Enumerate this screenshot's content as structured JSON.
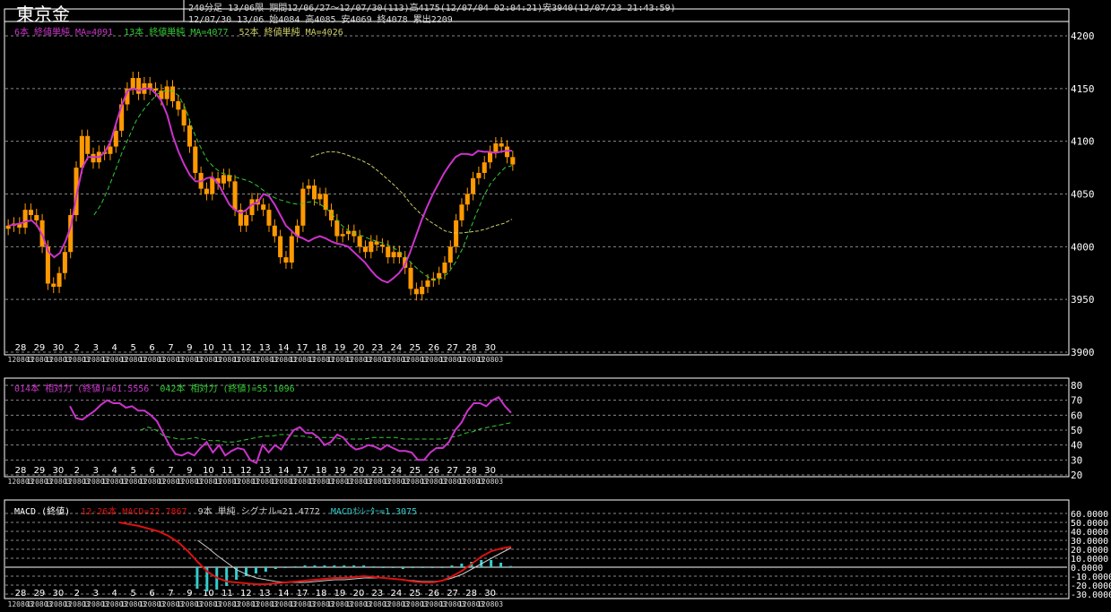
{
  "header": {
    "title": "東京金",
    "timeframe": "240分足 13/06限",
    "period": "期間12/06/27～12/07/30(113)高4175(12/07/04 02:04:21)安3940(12/07/23 21:43:59)",
    "last_bar": "12/07/30 13/06 始4084 高4085 安4069 終4078 累出2209"
  },
  "colors": {
    "background": "#000000",
    "candle_up": "#ff9900",
    "ma6": "#cc33cc",
    "ma13": "#33cc33",
    "ma52": "#cccc66",
    "rsi14": "#cc33cc",
    "rsi42": "#33cc33",
    "macd": "#dd1111",
    "signal": "#cccccc",
    "histogram": "#33cccc"
  },
  "legends": {
    "price": [
      {
        "text": "6本 終値単純 MA=4091",
        "color": "#cc33cc"
      },
      {
        "text": "13本 終値単純 MA=4077",
        "color": "#33cc33"
      },
      {
        "text": "52本 終値単純 MA=4026",
        "color": "#cccc66"
      }
    ],
    "rsi": [
      {
        "text": "014本 相対力 (終値)=61.5556",
        "color": "#cc33cc"
      },
      {
        "text": "042本 相対力 (終値)=55.1096",
        "color": "#33cc33"
      }
    ],
    "macd": [
      {
        "text": "MACD (終値)",
        "color": "#ffffff"
      },
      {
        "text": "12-26本 MACD=22.7867",
        "color": "#dd1111"
      },
      {
        "text": "9本 単純 シグナル=21.4772",
        "color": "#cccccc"
      },
      {
        "text": "MACDｵｼﾚｰﾀｰ=1.3075",
        "color": "#33cccc"
      }
    ]
  },
  "chart_data": [
    {
      "type": "candlestick",
      "title": "東京金 240分足 13/06限",
      "y_ticks": [
        3900,
        3950,
        4000,
        4050,
        4100,
        4150,
        4200
      ],
      "ylim": [
        3900,
        4200
      ],
      "x_tick_labels": [
        "28",
        "29",
        "30",
        "2",
        "3",
        "4",
        "5",
        "6",
        "7",
        "9",
        "10",
        "11",
        "12",
        "13",
        "14",
        "17",
        "18",
        "19",
        "20",
        "23",
        "24",
        "25",
        "26",
        "27",
        "28",
        "30"
      ],
      "x_tick_sublabels": "120803",
      "close": [
        4020,
        4022,
        4018,
        4035,
        4030,
        4025,
        4000,
        3965,
        3962,
        3975,
        3995,
        4030,
        4075,
        4105,
        4088,
        4080,
        4090,
        4088,
        4095,
        4110,
        4135,
        4150,
        4160,
        4145,
        4155,
        4150,
        4148,
        4140,
        4152,
        4138,
        4130,
        4115,
        4095,
        4070,
        4055,
        4050,
        4065,
        4060,
        4068,
        4062,
        4035,
        4020,
        4030,
        4045,
        4040,
        4035,
        4020,
        4010,
        3990,
        3985,
        4010,
        4020,
        4055,
        4058,
        4045,
        4050,
        4035,
        4025,
        4010,
        4012,
        4015,
        4010,
        4000,
        3995,
        4005,
        4002,
        4000,
        3990,
        3995,
        3990,
        3980,
        3960,
        3955,
        3962,
        3968,
        3970,
        3975,
        3985,
        4000,
        4025,
        4040,
        4050,
        4065,
        4070,
        4080,
        4090,
        4098,
        4095,
        4085,
        4078
      ],
      "ma6": [
        4020,
        4021,
        4022,
        4024,
        4025,
        4020,
        4010,
        3995,
        3990,
        3994,
        4005,
        4020,
        4050,
        4075,
        4085,
        4085,
        4085,
        4090,
        4100,
        4118,
        4135,
        4148,
        4150,
        4148,
        4150,
        4150,
        4145,
        4138,
        4125,
        4105,
        4090,
        4078,
        4068,
        4062,
        4062,
        4065,
        4066,
        4060,
        4050,
        4040,
        4035,
        4032,
        4035,
        4040,
        4042,
        4050,
        4048,
        4040,
        4030,
        4020,
        4015,
        4010,
        4008,
        4005,
        4008,
        4010,
        4008,
        4005,
        4003,
        4002,
        4000,
        3995,
        3990,
        3985,
        3978,
        3972,
        3968,
        3966,
        3970,
        3975,
        3982,
        3995,
        4010,
        4025,
        4038,
        4050,
        4060,
        4070,
        4078,
        4085,
        4088,
        4088,
        4087,
        4091,
        4090,
        4090,
        4089,
        4090,
        4091,
        4091
      ],
      "ma13": [
        null,
        null,
        null,
        null,
        null,
        null,
        null,
        null,
        null,
        null,
        null,
        null,
        4030,
        4040,
        4055,
        4072,
        4090,
        4105,
        4120,
        4130,
        4138,
        4145,
        4148,
        4148,
        4143,
        4130,
        4110,
        4095,
        4082,
        4075,
        4070,
        4068,
        4066,
        4064,
        4062,
        4058,
        4053,
        4048,
        4045,
        4043,
        4041,
        4040,
        4042,
        4043,
        4040,
        4035,
        4028,
        4020,
        4015,
        4012,
        4010,
        4007,
        4005,
        4003,
        4000,
        3996,
        3990,
        3983,
        3977,
        3972,
        3968,
        3970,
        3975,
        3985,
        3998,
        4015,
        4032,
        4048,
        4060,
        4068,
        4075,
        4077
      ],
      "ma52": [
        null,
        null,
        null,
        null,
        null,
        null,
        null,
        null,
        null,
        null,
        null,
        null,
        null,
        null,
        null,
        null,
        null,
        null,
        null,
        null,
        null,
        null,
        null,
        null,
        null,
        null,
        null,
        null,
        null,
        null,
        null,
        null,
        null,
        null,
        null,
        null,
        4085,
        4088,
        4090,
        4090,
        4088,
        4085,
        4082,
        4078,
        4072,
        4065,
        4058,
        4050,
        4040,
        4032,
        4025,
        4020,
        4015,
        4013,
        4013,
        4014,
        4015,
        4017,
        4020,
        4022,
        4026
      ]
    },
    {
      "type": "line",
      "title": "相対力 (終値)",
      "y_ticks": [
        20,
        30,
        40,
        50,
        60,
        70,
        80
      ],
      "ylim": [
        20,
        80
      ],
      "series": [
        {
          "name": "014本 相対力 (終値)",
          "values": [
            66,
            58,
            57,
            60,
            63,
            67,
            70,
            68,
            68,
            65,
            66,
            63,
            63,
            60,
            56,
            48,
            40,
            34,
            33,
            35,
            33,
            38,
            42,
            35,
            40,
            33,
            36,
            38,
            37,
            30,
            28,
            40,
            35,
            40,
            37,
            44,
            50,
            52,
            48,
            48,
            45,
            40,
            42,
            47,
            45,
            40,
            37,
            38,
            40,
            39,
            37,
            40,
            38,
            36,
            36,
            35,
            30,
            30,
            35,
            38,
            38,
            42,
            50,
            55,
            63,
            68,
            68,
            66,
            70,
            72,
            66,
            61.5556
          ]
        },
        {
          "name": "042本 相対力 (終値)",
          "values": [
            null,
            null,
            null,
            null,
            null,
            null,
            null,
            null,
            null,
            null,
            null,
            null,
            null,
            null,
            null,
            null,
            null,
            50,
            52,
            50,
            46,
            45,
            44,
            44,
            45,
            44,
            43,
            43,
            42,
            42,
            43,
            44,
            45,
            46,
            46,
            47,
            47,
            46,
            46,
            45,
            45,
            45,
            45,
            44,
            44,
            44,
            44,
            45,
            45,
            45,
            45,
            44,
            44,
            44,
            44,
            44,
            44,
            45,
            46,
            48,
            49,
            51,
            52,
            53,
            54,
            55.1096
          ]
        }
      ]
    },
    {
      "type": "line+bar",
      "title": "MACD (終値)",
      "y_ticks": [
        -30,
        -20,
        -10,
        0,
        10,
        20,
        30,
        40,
        50,
        60
      ],
      "y_tick_labels": [
        "-30.0000",
        "-20.0000",
        "-10.0000",
        "0.0000",
        "10.0000",
        "20.0000",
        "30.0000",
        "40.0000",
        "50.0000",
        "60.0000"
      ],
      "ylim": [
        -32,
        62
      ],
      "series": [
        {
          "name": "12-26本 MACD",
          "values": [
            50,
            48,
            46,
            43,
            40,
            35,
            28,
            18,
            6,
            -5,
            -12,
            -16,
            -17,
            -18,
            -19,
            -19,
            -18,
            -17,
            -16,
            -15,
            -14,
            -13,
            -12,
            -12,
            -11,
            -10,
            -11,
            -12,
            -13,
            -14,
            -16,
            -17,
            -17,
            -15,
            -10,
            -4,
            4,
            12,
            18,
            21,
            22.7867
          ]
        },
        {
          "name": "9本 単純 シグナル",
          "values": [
            null,
            null,
            null,
            null,
            null,
            null,
            null,
            null,
            30,
            22,
            13,
            5,
            -3,
            -8,
            -12,
            -14,
            -16,
            -17,
            -17,
            -17,
            -16,
            -15,
            -14,
            -14,
            -13,
            -12,
            -12,
            -12,
            -13,
            -14,
            -15,
            -16,
            -16,
            -15,
            -12,
            -8,
            -2,
            4,
            10,
            16,
            21.4772
          ]
        },
        {
          "name": "MACDｵｼﾚｰﾀｰ",
          "values": [
            null,
            null,
            null,
            null,
            null,
            null,
            null,
            null,
            -24,
            -27,
            -25,
            -21,
            -14,
            -10,
            -7,
            -5,
            -2,
            0,
            1,
            2,
            2,
            2,
            2,
            2,
            2,
            2,
            1,
            0,
            -1,
            -2,
            -1,
            -1,
            -1,
            0,
            2,
            4,
            6,
            8,
            8,
            5,
            1.3075
          ]
        }
      ]
    }
  ]
}
